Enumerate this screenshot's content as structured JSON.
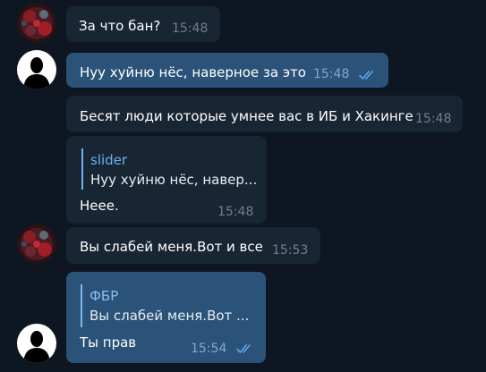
{
  "messages": [
    {
      "text": "За что бан?",
      "time": "15:48"
    },
    {
      "text": "Нуу хуйню нёс, наверное за это",
      "time": "15:48"
    },
    {
      "text": "Бесят люди которые умнее вас в ИБ и Хакинге",
      "time": "15:48"
    },
    {
      "reply_author": "slider",
      "reply_text": "Нуу хуйню нёс, навер...",
      "text": "Нeee.",
      "time": "15:48"
    },
    {
      "text": "Вы слабей меня.Вот и все",
      "time": "15:53"
    },
    {
      "reply_author": "ФБР",
      "reply_text": "Вы слабей меня.Вот ...",
      "text": "Ты прав",
      "time": "15:54"
    }
  ],
  "colors": {
    "background": "#0e1621",
    "incoming_bubble": "#182533",
    "outgoing_bubble": "#2b5278",
    "reply_accent": "#6ab2f2",
    "read_ticks": "#5ea8e8"
  },
  "icons": {
    "read_status": "double-check-icon",
    "contact_avatar": "contact-avatar",
    "own_avatar": "silhouette-avatar"
  }
}
